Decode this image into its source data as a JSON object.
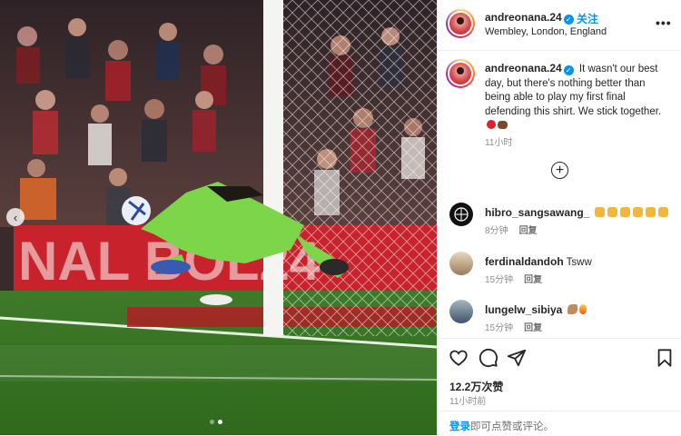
{
  "post": {
    "username": "andreonana.24",
    "verified": true,
    "follow_label": "关注",
    "location": "Wembley, London, England",
    "more_icon": "more-horizontal-icon",
    "caption_text": "It wasn't our best day, but there's nothing better than being able to play my first final defending this shirt. We stick together.",
    "caption_time": "11小时",
    "load_more_icon": "plus-circle-icon"
  },
  "photo": {
    "prev_icon": "chevron-left-icon",
    "carousel_dots": 2,
    "active_dot": 1
  },
  "comments": [
    {
      "username": "hibro_sangsawang_",
      "text": "",
      "emoji": "clap x6",
      "time": "8分钟",
      "reply_label": "回复"
    },
    {
      "username": "ferdinaldandoh",
      "text": "Tsww",
      "emoji": "",
      "time": "15分钟",
      "reply_label": "回复"
    },
    {
      "username": "lungelw_sibiya",
      "text": "",
      "emoji": "muscle fire",
      "time": "15分钟",
      "reply_label": "回复"
    }
  ],
  "actions": {
    "like_icon": "heart-icon",
    "comment_icon": "comment-icon",
    "share_icon": "share-icon",
    "save_icon": "bookmark-icon"
  },
  "stats": {
    "likes": "12.2万次赞",
    "post_time": "11小时前"
  },
  "login_prompt": {
    "link": "登录",
    "rest": "即可点赞或评论。"
  },
  "colors": {
    "accent": "#0095f6",
    "text": "#262626",
    "muted": "#8e8e8e",
    "divider": "#efefef"
  }
}
